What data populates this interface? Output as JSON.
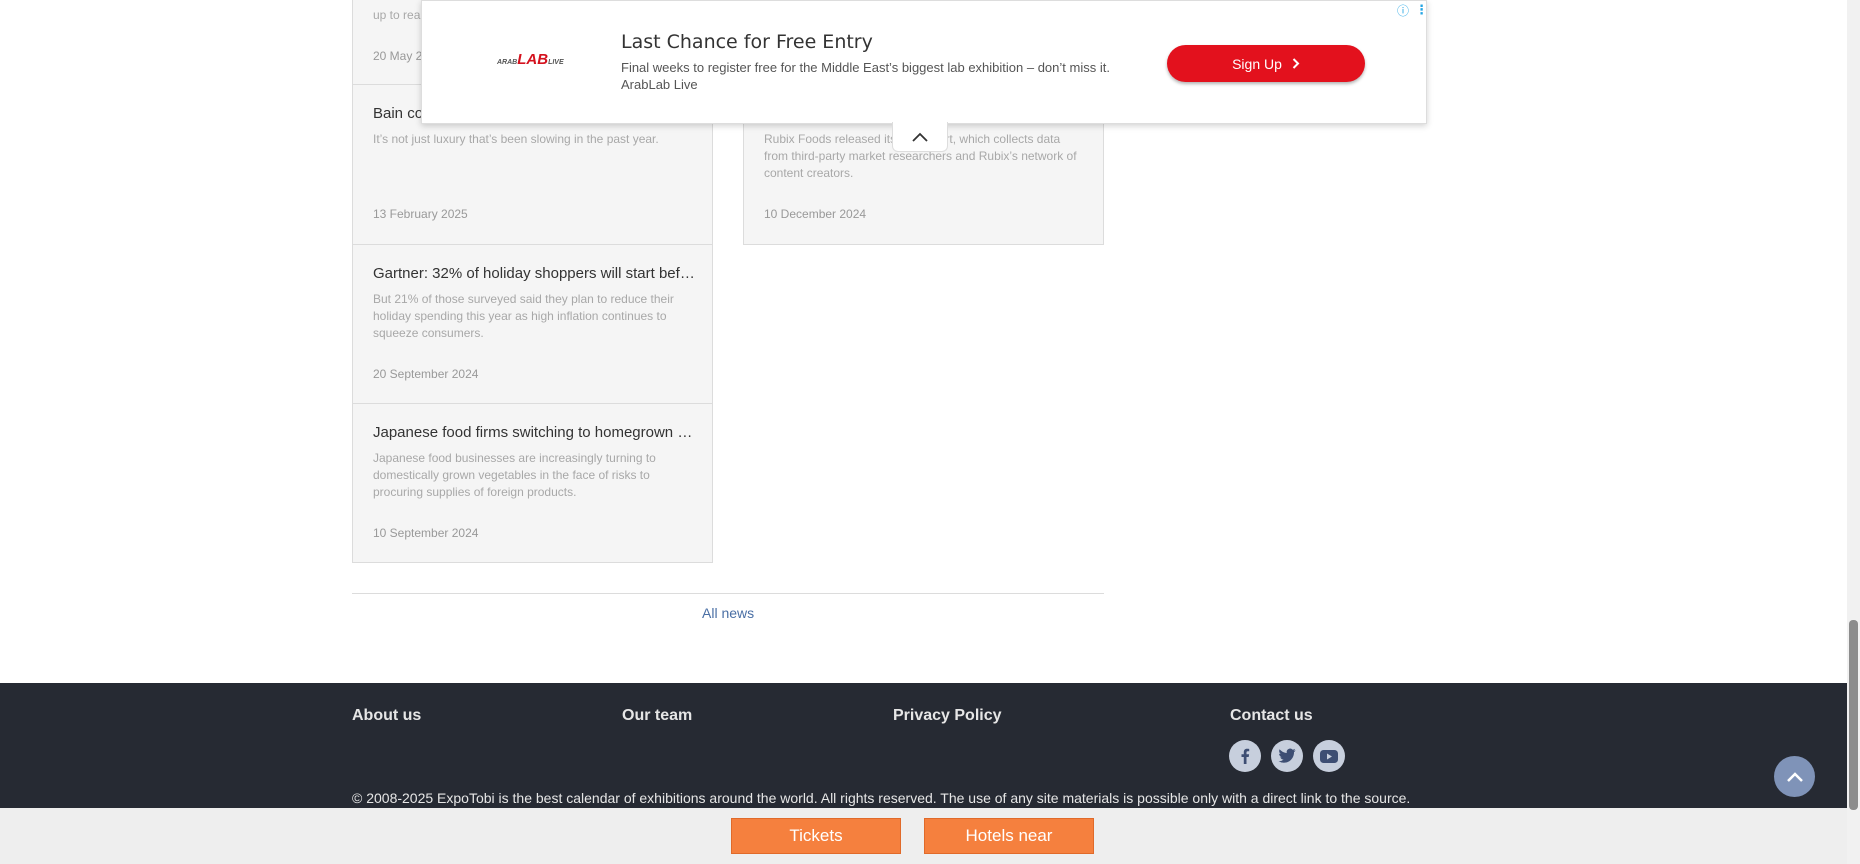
{
  "news_cards": [
    {
      "title": "",
      "desc_line": "up to rea",
      "date": "20 May 2"
    },
    {
      "title": "Bain co",
      "description": "It’s not just luxury that’s been slowing in the past year.",
      "date": "13 February 2025"
    },
    {
      "title": "",
      "description": "Rubix Foods released its                          for Report, which collects data from third-party market researchers and Rubix’s network of content creators.",
      "date": "10 December 2024"
    },
    {
      "title": "Gartner: 32% of holiday shoppers will start before...",
      "description": "But 21% of those surveyed said they plan to reduce their holiday spending this year as high inflation continues to squeeze consumers.",
      "date": "20 September 2024"
    },
    {
      "title": "Japanese food firms switching to homegrown ve...",
      "description": "Japanese food businesses are increasingly turning to domestically grown vegetables in the face of risks to procuring supplies of foreign products.",
      "date": "10 September 2024"
    }
  ],
  "all_news_label": "All news",
  "footer": {
    "links": [
      "About us",
      "Our team",
      "Privacy Policy",
      "Contact us"
    ],
    "social_icons": [
      "facebook-icon",
      "twitter-icon",
      "youtube-icon"
    ],
    "copyright": "© 2008-2025 ExpoTobi is the best calendar of exhibitions around the world. All rights reserved. The use of any site materials is possible only with a direct link to the source."
  },
  "bottom_bar": {
    "tickets_label": "Tickets",
    "hotels_label": "Hotels near"
  },
  "ad": {
    "logo_text": "LAB",
    "logo_prefix": "ARAB",
    "logo_suffix": "LIVE",
    "title": "Last Chance for Free Entry",
    "description": "Final weeks to register free for the Middle East’s biggest lab exhibition – don’t miss it.",
    "advertiser": "ArabLab Live",
    "cta_label": "Sign Up",
    "info_icon": "ⓘ",
    "menu_icon": "⋮"
  },
  "colors": {
    "footer_bg": "#262a33",
    "accent_orange": "#f5803e",
    "ad_red": "#e3111d",
    "link_blue": "#4a6fa5"
  }
}
